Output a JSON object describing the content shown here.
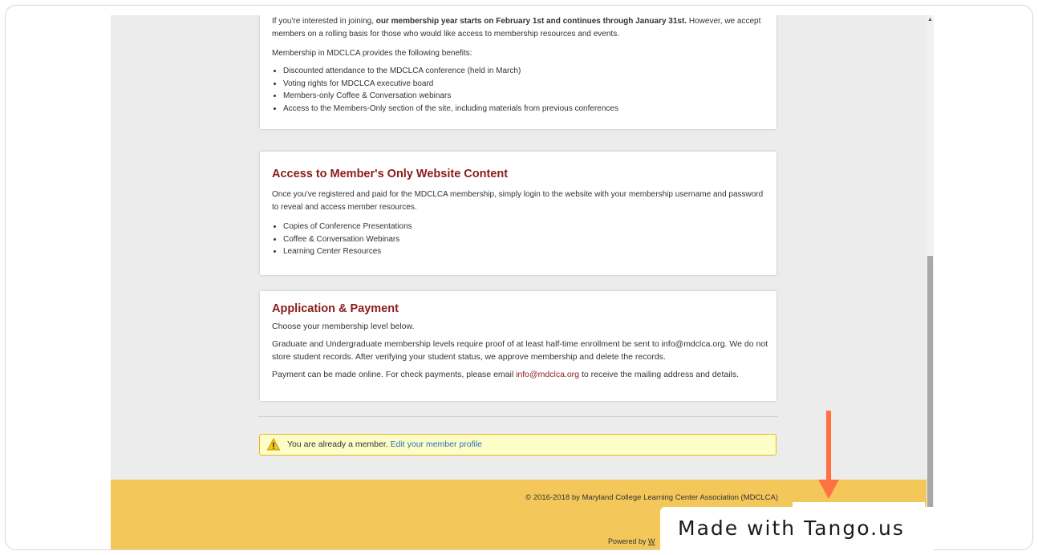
{
  "card1": {
    "intro_a": "If you're interested in joining, ",
    "intro_bold": "our membership year starts on February 1st and continues through January 31st.",
    "intro_b": " However, we accept members on a rolling basis for those who would like access to membership resources and events.",
    "benefits_lead": "Membership in MDCLCA provides the following benefits:",
    "benefits": [
      "Discounted attendance to the MDCLCA conference (held in March)",
      "Voting rights for MDCLCA executive board",
      "Members-only Coffee & Conversation webinars",
      "Access to the Members-Only section of the site, including materials from previous conferences"
    ]
  },
  "card2": {
    "title": "Access to Member's Only Website Content",
    "body": "Once you've registered and paid for the MDCLCA membership, simply login to the website with your membership username and password to reveal and access member resources.",
    "items": [
      "Copies of Conference Presentations",
      "Coffee & Conversation Webinars",
      "Learning Center Resources"
    ]
  },
  "card3": {
    "title": "Application & Payment",
    "p1": "Choose your membership level below.",
    "p2": "Graduate and Undergraduate membership levels require proof of at least half-time enrollment be sent to info@mdclca.org. We do not store student records. After verifying your student status, we approve membership and delete the records.",
    "p3_a": "Payment can be made online. For check payments, please email ",
    "p3_link": "info@mdclca.org",
    "p3_b": " to receive the mailing address and details."
  },
  "notice": {
    "text": "You are already a member.",
    "link": "Edit your member profile",
    "icon": "warning-icon"
  },
  "footer": {
    "copyright": "© 2016-2018 by Maryland College Learning Center Association (MDCLCA)",
    "powered_by": "Powered by",
    "powered_link_partial": "W"
  },
  "overlay": {
    "tango_label": "Made with Tango.us"
  },
  "colors": {
    "heading": "#8b1a1a",
    "footer_bg": "#f3c75a",
    "notice_bg": "#fdfdc8",
    "notice_border": "#e8b820",
    "arrow": "#ff7043",
    "link_blue": "#2b73b8"
  }
}
